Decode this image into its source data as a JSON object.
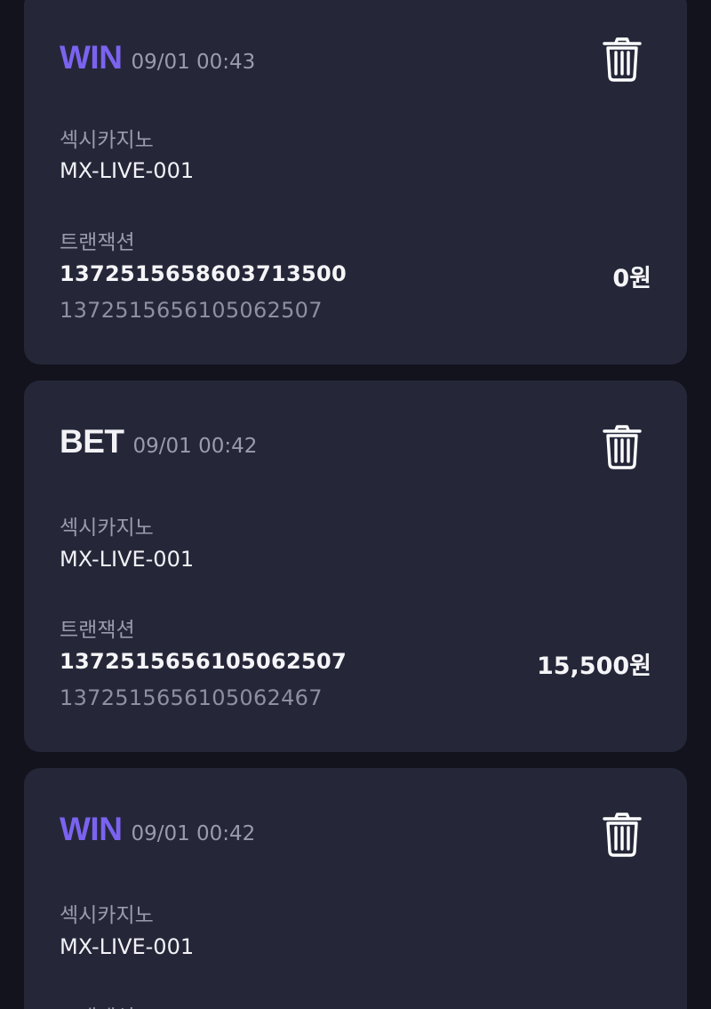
{
  "transactions": [
    {
      "type": "WIN",
      "datetime": "09/01 00:43",
      "casino": "섹시카지노",
      "game_id": "MX-LIVE-001",
      "transaction_label": "트랜잭션",
      "transaction_id": "1372515658603713500",
      "reference_id": "1372515656105062507",
      "amount": "0원"
    },
    {
      "type": "BET",
      "datetime": "09/01 00:42",
      "casino": "섹시카지노",
      "game_id": "MX-LIVE-001",
      "transaction_label": "트랜잭션",
      "transaction_id": "1372515656105062507",
      "reference_id": "1372515656105062467",
      "amount": "15,500원"
    },
    {
      "type": "WIN",
      "datetime": "09/01 00:42",
      "casino": "섹시카지노",
      "game_id": "MX-LIVE-001",
      "transaction_label": "트랜잭션"
    }
  ],
  "colors": {
    "background": "#12131d",
    "card": "#252739",
    "win_accent": "#7b63f0",
    "text_primary": "#f2f2f6",
    "text_secondary": "#9a9cab"
  },
  "icons": {
    "delete": "trash-icon"
  }
}
